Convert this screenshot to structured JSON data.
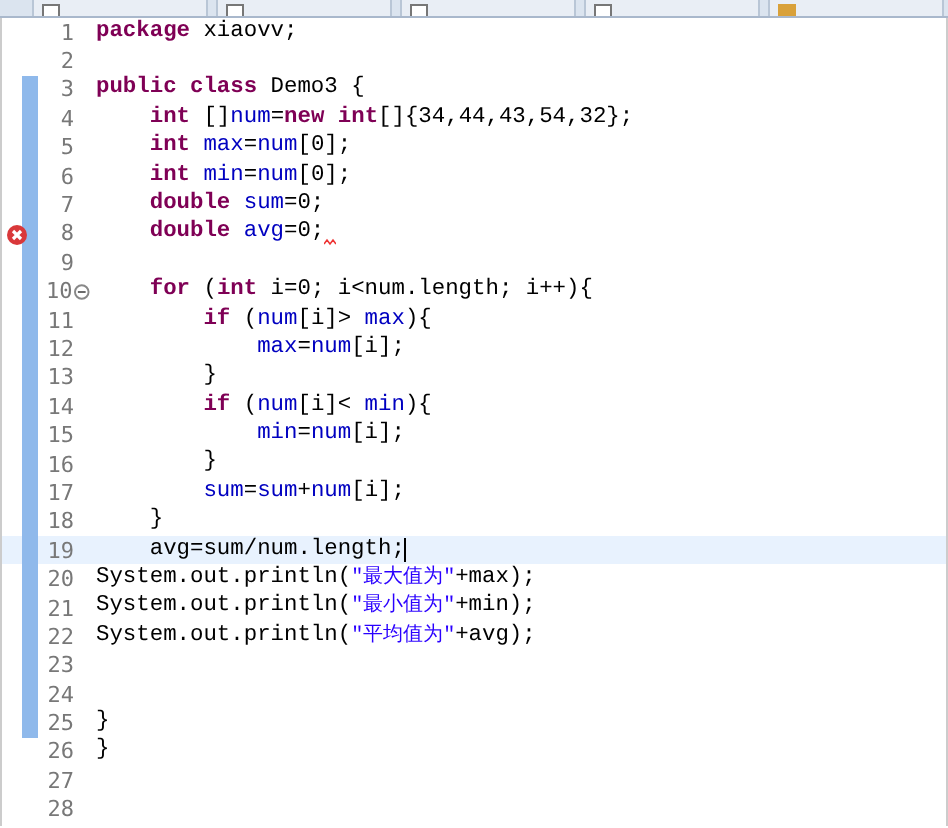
{
  "editor_tabs": [
    {
      "kind": "file"
    },
    {
      "kind": "file"
    },
    {
      "kind": "file"
    },
    {
      "kind": "file"
    },
    {
      "kind": "package"
    }
  ],
  "lines": [
    {
      "number": "1",
      "changed": false,
      "current": false,
      "error": false,
      "fold": false,
      "tokens": [
        {
          "kind": "keyword",
          "text": "package"
        },
        {
          "kind": "plain",
          "text": " xiaovv;"
        }
      ]
    },
    {
      "number": "2",
      "changed": false,
      "current": false,
      "error": false,
      "fold": false
    },
    {
      "number": "3",
      "changed": true,
      "current": false,
      "error": false,
      "fold": false,
      "tokens": [
        {
          "kind": "keyword",
          "text": "public class"
        },
        {
          "kind": "plain",
          "text": " Demo3 {"
        }
      ]
    },
    {
      "number": "4",
      "changed": true,
      "current": false,
      "error": false,
      "fold": false,
      "tokens": [
        {
          "kind": "keyword",
          "text": "    int"
        },
        {
          "kind": "plain",
          "text": " []"
        },
        {
          "kind": "field",
          "text": "num"
        },
        {
          "kind": "plain",
          "text": "="
        },
        {
          "kind": "keyword",
          "text": "new int"
        },
        {
          "kind": "plain",
          "text": "[]{34,44,43,54,32};"
        }
      ]
    },
    {
      "number": "5",
      "changed": true,
      "current": false,
      "error": false,
      "fold": false,
      "tokens": [
        {
          "kind": "keyword",
          "text": "    int"
        },
        {
          "kind": "field",
          "text": " max"
        },
        {
          "kind": "plain",
          "text": "="
        },
        {
          "kind": "field",
          "text": "num"
        },
        {
          "kind": "plain",
          "text": "[0];"
        }
      ]
    },
    {
      "number": "6",
      "changed": true,
      "current": false,
      "error": false,
      "fold": false,
      "tokens": [
        {
          "kind": "keyword",
          "text": "    int"
        },
        {
          "kind": "field",
          "text": " min"
        },
        {
          "kind": "plain",
          "text": "="
        },
        {
          "kind": "field",
          "text": "num"
        },
        {
          "kind": "plain",
          "text": "[0];"
        }
      ]
    },
    {
      "number": "7",
      "changed": true,
      "current": false,
      "error": false,
      "fold": false,
      "tokens": [
        {
          "kind": "keyword",
          "text": "    double"
        },
        {
          "kind": "field",
          "text": " sum"
        },
        {
          "kind": "plain",
          "text": "=0;"
        }
      ]
    },
    {
      "number": "8",
      "changed": true,
      "current": false,
      "error": true,
      "fold": false,
      "tokens": [
        {
          "kind": "keyword",
          "text": "    double"
        },
        {
          "kind": "field",
          "text": " avg"
        },
        {
          "kind": "plain",
          "text": "=0;"
        }
      ]
    },
    {
      "number": "9",
      "changed": true,
      "current": false,
      "error": false,
      "fold": false
    },
    {
      "number": "10",
      "changed": true,
      "current": false,
      "error": false,
      "fold": true,
      "tokens": [
        {
          "kind": "keyword",
          "text": "    for"
        },
        {
          "kind": "plain",
          "text": " ("
        },
        {
          "kind": "keyword",
          "text": "int"
        },
        {
          "kind": "plain",
          "text": " i=0; i<num.length; i++){"
        }
      ]
    },
    {
      "number": "11",
      "changed": true,
      "current": false,
      "error": false,
      "fold": false,
      "tokens": [
        {
          "kind": "keyword",
          "text": "        if"
        },
        {
          "kind": "plain",
          "text": " ("
        },
        {
          "kind": "field",
          "text": "num"
        },
        {
          "kind": "plain",
          "text": "[i]>"
        },
        {
          "kind": "field",
          "text": " max"
        },
        {
          "kind": "plain",
          "text": "){"
        }
      ]
    },
    {
      "number": "12",
      "changed": true,
      "current": false,
      "error": false,
      "fold": false,
      "tokens": [
        {
          "kind": "field",
          "text": "            max"
        },
        {
          "kind": "plain",
          "text": "="
        },
        {
          "kind": "field",
          "text": "num"
        },
        {
          "kind": "plain",
          "text": "[i];"
        }
      ]
    },
    {
      "number": "13",
      "changed": true,
      "current": false,
      "error": false,
      "fold": false,
      "tokens": [
        {
          "kind": "plain",
          "text": "        }"
        }
      ]
    },
    {
      "number": "14",
      "changed": true,
      "current": false,
      "error": false,
      "fold": false,
      "tokens": [
        {
          "kind": "keyword",
          "text": "        if"
        },
        {
          "kind": "plain",
          "text": " ("
        },
        {
          "kind": "field",
          "text": "num"
        },
        {
          "kind": "plain",
          "text": "[i]<"
        },
        {
          "kind": "field",
          "text": " min"
        },
        {
          "kind": "plain",
          "text": "){"
        }
      ]
    },
    {
      "number": "15",
      "changed": true,
      "current": false,
      "error": false,
      "fold": false,
      "tokens": [
        {
          "kind": "field",
          "text": "            min"
        },
        {
          "kind": "plain",
          "text": "="
        },
        {
          "kind": "field",
          "text": "num"
        },
        {
          "kind": "plain",
          "text": "[i];"
        }
      ]
    },
    {
      "number": "16",
      "changed": true,
      "current": false,
      "error": false,
      "fold": false,
      "tokens": [
        {
          "kind": "plain",
          "text": "        }"
        }
      ]
    },
    {
      "number": "17",
      "changed": true,
      "current": false,
      "error": false,
      "fold": false,
      "tokens": [
        {
          "kind": "field",
          "text": "        sum"
        },
        {
          "kind": "plain",
          "text": "="
        },
        {
          "kind": "field",
          "text": "sum"
        },
        {
          "kind": "plain",
          "text": "+"
        },
        {
          "kind": "field",
          "text": "num"
        },
        {
          "kind": "plain",
          "text": "[i];"
        }
      ]
    },
    {
      "number": "18",
      "changed": true,
      "current": false,
      "error": false,
      "fold": false,
      "tokens": [
        {
          "kind": "plain",
          "text": "    }"
        }
      ]
    },
    {
      "number": "19",
      "changed": true,
      "current": true,
      "error": false,
      "fold": false,
      "tokens": [
        {
          "kind": "plain",
          "text": "    avg=sum/num.length;"
        }
      ]
    },
    {
      "number": "20",
      "changed": true,
      "current": false,
      "error": false,
      "fold": false,
      "tokens": [
        {
          "kind": "plain",
          "text": "System.out.println("
        },
        {
          "kind": "string",
          "text": "\"最大值为\""
        },
        {
          "kind": "plain",
          "text": "+max);"
        }
      ]
    },
    {
      "number": "21",
      "changed": true,
      "current": false,
      "error": false,
      "fold": false,
      "tokens": [
        {
          "kind": "plain",
          "text": "System.out.println("
        },
        {
          "kind": "string",
          "text": "\"最小值为\""
        },
        {
          "kind": "plain",
          "text": "+min);"
        }
      ]
    },
    {
      "number": "22",
      "changed": true,
      "current": false,
      "error": false,
      "fold": false,
      "tokens": [
        {
          "kind": "plain",
          "text": "System.out.println("
        },
        {
          "kind": "string",
          "text": "\"平均值为\""
        },
        {
          "kind": "plain",
          "text": "+avg);"
        }
      ]
    },
    {
      "number": "23",
      "changed": true,
      "current": false,
      "error": false,
      "fold": false
    },
    {
      "number": "24",
      "changed": true,
      "current": false,
      "error": false,
      "fold": false
    },
    {
      "number": "25",
      "changed": true,
      "current": false,
      "error": false,
      "fold": false,
      "tokens": [
        {
          "kind": "plain",
          "text": "}"
        }
      ]
    },
    {
      "number": "26",
      "changed": false,
      "current": false,
      "error": false,
      "fold": false,
      "tokens": [
        {
          "kind": "plain",
          "text": "}"
        }
      ]
    },
    {
      "number": "27",
      "changed": false,
      "current": false,
      "error": false,
      "fold": false
    },
    {
      "number": "28",
      "changed": false,
      "current": false,
      "error": false,
      "fold": false
    }
  ]
}
